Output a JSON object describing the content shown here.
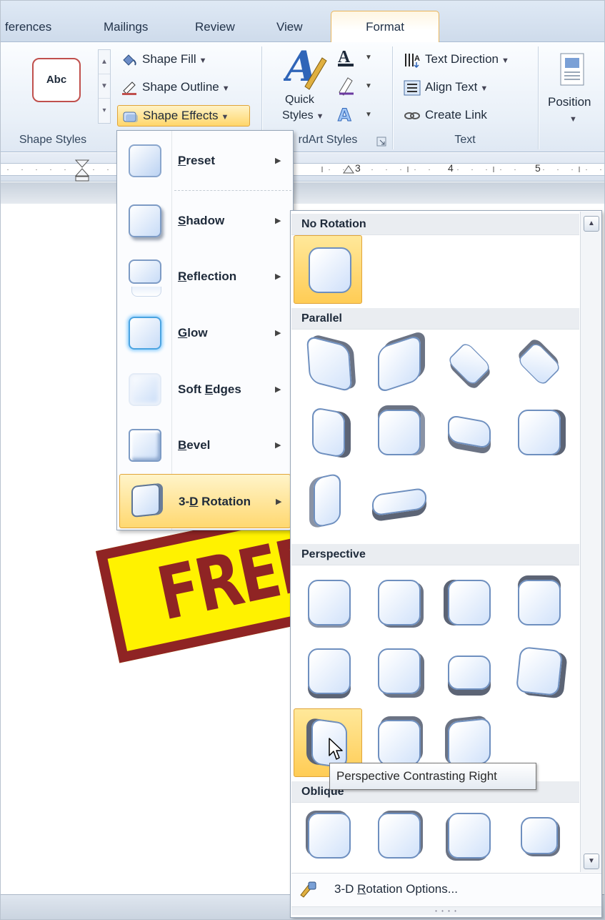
{
  "tabs": {
    "references": "ferences",
    "mailings": "Mailings",
    "review": "Review",
    "view": "View",
    "format": "Format"
  },
  "ribbon": {
    "shape_styles": {
      "preview_text": "Abc",
      "shape_fill": "Shape Fill",
      "shape_outline": "Shape Outline",
      "shape_effects": "Shape Effects",
      "group_label": "Shape Styles"
    },
    "wordart": {
      "quick_styles_line1": "Quick",
      "quick_styles_line2": "Styles",
      "group_label": "rdArt Styles"
    },
    "text": {
      "text_direction": "Text Direction",
      "align_text": "Align Text",
      "create_link": "Create Link",
      "group_label": "Text"
    },
    "arrange": {
      "position": "Position"
    }
  },
  "ruler": {
    "marks": [
      "3",
      "4",
      "5"
    ]
  },
  "document": {
    "banner_text": "FREE"
  },
  "effects_menu": {
    "items": [
      {
        "label_pre": "",
        "label_key": "P",
        "label_post": "reset"
      },
      {
        "label_pre": "",
        "label_key": "S",
        "label_post": "hadow"
      },
      {
        "label_pre": "",
        "label_key": "R",
        "label_post": "eflection"
      },
      {
        "label_pre": "",
        "label_key": "G",
        "label_post": "low"
      },
      {
        "label_pre": "Soft ",
        "label_key": "E",
        "label_post": "dges"
      },
      {
        "label_pre": "",
        "label_key": "B",
        "label_post": "evel"
      },
      {
        "label_pre": "3-",
        "label_key": "D",
        "label_post": " Rotation"
      }
    ],
    "active_index": 6
  },
  "rotation_gallery": {
    "sections": {
      "no_rotation": "No Rotation",
      "parallel": "Parallel",
      "perspective": "Perspective",
      "oblique": "Oblique"
    },
    "footer_pre": "3-D ",
    "footer_key": "R",
    "footer_post": "otation Options..."
  },
  "tooltip": "Perspective Contrasting Right",
  "colors": {
    "accent_orange": "#ffd66b",
    "banner_yellow": "#fff200",
    "banner_red": "#8f2424",
    "shape_blue": "#6e8fbf"
  }
}
